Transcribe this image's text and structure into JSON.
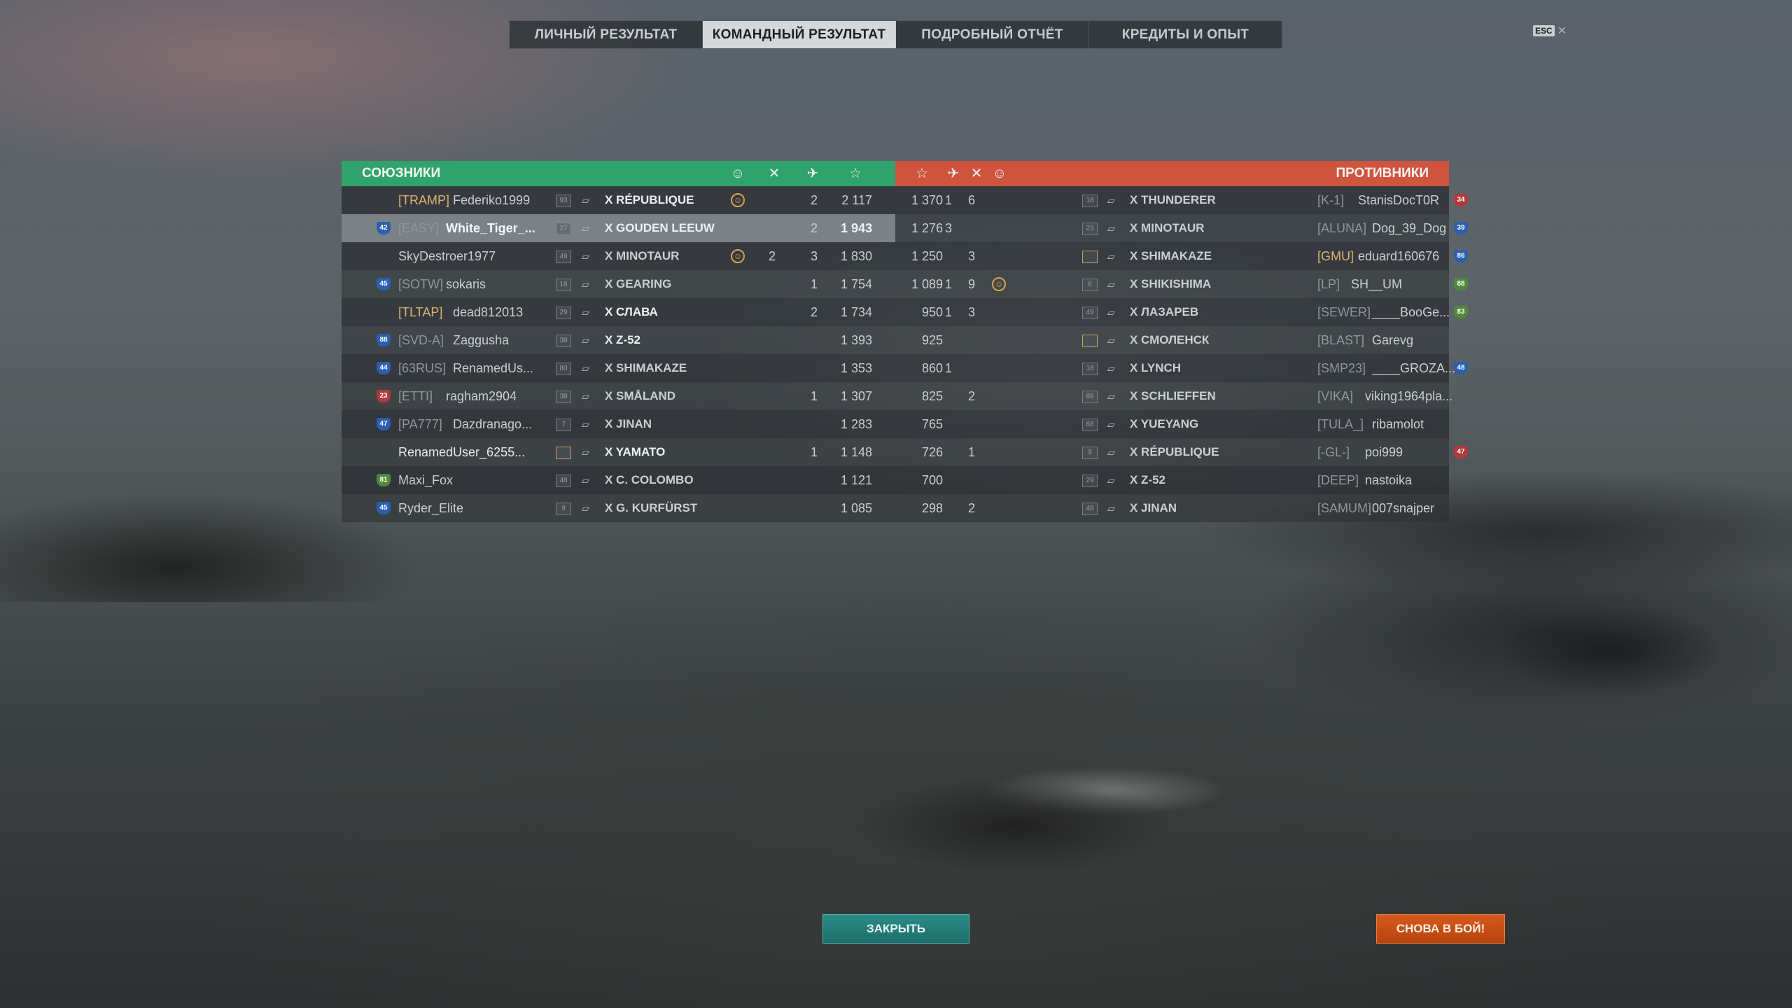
{
  "tabs": [
    {
      "label": "ЛИЧНЫЙ РЕЗУЛЬТАТ",
      "active": false
    },
    {
      "label": "КОМАНДНЫЙ РЕЗУЛЬТАТ",
      "active": true
    },
    {
      "label": "ПОДРОБНЫЙ ОТЧЁТ",
      "active": false
    },
    {
      "label": "КРЕДИТЫ И ОПЫТ",
      "active": false
    }
  ],
  "esc_label": "ESC",
  "allies_title": "СОЮЗНИКИ",
  "enemies_title": "ПРОТИВНИКИ",
  "allies": [
    {
      "rank": "",
      "rank_color": "",
      "clan": "[TRAMP]",
      "clan_gold": true,
      "name": "Federiko1999",
      "level": "93",
      "ship": "X RÉPUBLIQUE",
      "medal": true,
      "c1": "",
      "c2": "2",
      "xp": "2 117"
    },
    {
      "rank": "42",
      "rank_color": "blue",
      "clan": "[EASY]",
      "clan_gold": false,
      "name": "White_Tiger_...",
      "me": true,
      "level": "27",
      "ship": "X GOUDEN LEEUW",
      "medal": false,
      "c1": "",
      "c2": "2",
      "xp": "1 943"
    },
    {
      "rank": "",
      "rank_color": "",
      "clan": "",
      "clan_gold": false,
      "name": "SkyDestroer1977",
      "level": "49",
      "ship": "X MINOTAUR",
      "medal": true,
      "c1": "2",
      "c2": "3",
      "xp": "1 830"
    },
    {
      "rank": "45",
      "rank_color": "blue",
      "clan": "[SOTW]",
      "clan_gold": false,
      "name": "sokaris",
      "level": "18",
      "ship": "X GEARING",
      "medal": false,
      "c1": "",
      "c2": "1",
      "xp": "1 754"
    },
    {
      "rank": "",
      "rank_color": "",
      "clan": "[TLTAP]",
      "clan_gold": true,
      "name": "dead812013",
      "level": "29",
      "ship": "X СЛАВА",
      "medal": false,
      "c1": "",
      "c2": "2",
      "xp": "1 734"
    },
    {
      "rank": "88",
      "rank_color": "blue",
      "clan": "[SVD-A]",
      "clan_gold": false,
      "name": "Zaggusha",
      "level": "38",
      "ship": "X Z-52",
      "medal": false,
      "c1": "",
      "c2": "",
      "xp": "1 393"
    },
    {
      "rank": "44",
      "rank_color": "blue",
      "clan": "[63RUS]",
      "clan_gold": false,
      "name": "RenamedUs...",
      "level": "80",
      "ship": "X SHIMAKAZE",
      "medal": false,
      "c1": "",
      "c2": "",
      "xp": "1 353"
    },
    {
      "rank": "23",
      "rank_color": "red",
      "clan": "[ETTI]",
      "clan_gold": false,
      "name": "ragham2904",
      "level": "38",
      "ship": "X SMÅLAND",
      "medal": false,
      "c1": "",
      "c2": "1",
      "xp": "1 307"
    },
    {
      "rank": "47",
      "rank_color": "blue",
      "clan": "[PA777]",
      "clan_gold": false,
      "name": "Dazdranago...",
      "level": "7",
      "ship": "X JINAN",
      "medal": false,
      "c1": "",
      "c2": "",
      "xp": "1 283"
    },
    {
      "rank": "",
      "rank_color": "",
      "clan": "",
      "clan_gold": false,
      "name": "RenamedUser_6255...",
      "white": true,
      "level": "",
      "ship": "X YAMATO",
      "medal": false,
      "c1": "",
      "c2": "1",
      "xp": "1 148"
    },
    {
      "rank": "81",
      "rank_color": "green",
      "clan": "",
      "clan_gold": false,
      "name": "Maxi_Fox",
      "level": "48",
      "ship": "X C. COLOMBO",
      "medal": false,
      "c1": "",
      "c2": "",
      "xp": "1 121"
    },
    {
      "rank": "45",
      "rank_color": "blue",
      "clan": "",
      "clan_gold": false,
      "name": "Ryder_Elite",
      "level": "9",
      "ship": "X G. KURFÜRST",
      "medal": false,
      "c1": "",
      "c2": "",
      "xp": "1 085"
    }
  ],
  "enemies": [
    {
      "xp": "1 370",
      "c2": "1",
      "c1": "6",
      "medal": false,
      "level": "18",
      "ship": "X THUNDERER",
      "clan": "[K-1]",
      "name": "StanisDocT0R",
      "rank": "34",
      "rank_color": "red"
    },
    {
      "xp": "1 276",
      "c2": "3",
      "c1": "",
      "medal": false,
      "level": "23",
      "ship": "X MINOTAUR",
      "clan": "[ALUNA]",
      "name": "Dog_39_Dog",
      "rank": "39",
      "rank_color": "blue"
    },
    {
      "xp": "1 250",
      "c2": "",
      "c1": "3",
      "medal": false,
      "level": "",
      "ship": "X SHIMAKAZE",
      "clan": "[GMU]",
      "clan_gold": true,
      "name": "eduard160676",
      "rank": "86",
      "rank_color": "blue"
    },
    {
      "xp": "1 089",
      "c2": "1",
      "c1": "9",
      "medal": true,
      "level": "6",
      "ship": "X SHIKISHIMA",
      "clan": "[LP]",
      "name": "SH__UM",
      "rank": "88",
      "rank_color": "green"
    },
    {
      "xp": "950",
      "c2": "1",
      "c1": "3",
      "medal": false,
      "level": "49",
      "ship": "X ЛАЗАРЕВ",
      "clan": "[SEWER]",
      "name": "____BooGe...",
      "rank": "83",
      "rank_color": "green"
    },
    {
      "xp": "925",
      "c2": "",
      "c1": "",
      "medal": false,
      "level": "",
      "ship": "X СМОЛЕНСК",
      "clan": "[BLAST]",
      "name": "Garevg",
      "rank": "",
      "rank_color": ""
    },
    {
      "xp": "860",
      "c2": "1",
      "c1": "",
      "medal": false,
      "level": "18",
      "ship": "X LYNCH",
      "clan": "[SMP23]",
      "name": "____GROZA...",
      "rank": "48",
      "rank_color": "blue"
    },
    {
      "xp": "825",
      "c2": "",
      "c1": "2",
      "medal": false,
      "level": "88",
      "ship": "X SCHLIEFFEN",
      "clan": "[VIKA]",
      "name": "viking1964pla...",
      "rank": "",
      "rank_color": ""
    },
    {
      "xp": "765",
      "c2": "",
      "c1": "",
      "medal": false,
      "level": "88",
      "ship": "X YUEYANG",
      "clan": "[TULA_]",
      "name": "ribamolot",
      "rank": "",
      "rank_color": ""
    },
    {
      "xp": "726",
      "c2": "",
      "c1": "1",
      "medal": false,
      "level": "9",
      "ship": "X RÉPUBLIQUE",
      "clan": "[-GL-]",
      "name": "poi999",
      "rank": "47",
      "rank_color": "red"
    },
    {
      "xp": "700",
      "c2": "",
      "c1": "",
      "medal": false,
      "level": "29",
      "ship": "X Z-52",
      "clan": "[DEEP]",
      "name": "nastoika",
      "rank": "",
      "rank_color": ""
    },
    {
      "xp": "298",
      "c2": "",
      "c1": "2",
      "medal": false,
      "level": "48",
      "ship": "X JINAN",
      "clan": "[SAMUM]",
      "name": "007snajper",
      "rank": "",
      "rank_color": ""
    }
  ],
  "buttons": {
    "close": "ЗАКРЫТЬ",
    "battle": "СНОВА В БОЙ!"
  }
}
